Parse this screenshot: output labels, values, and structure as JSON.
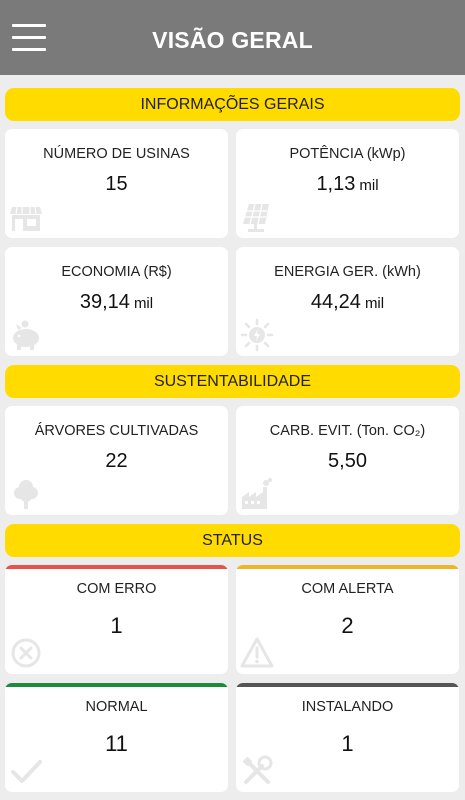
{
  "header": {
    "title": "VISÃO GERAL",
    "menu_icon": "hamburger-menu-icon",
    "bg_color": "#7a7a7a"
  },
  "sections": {
    "general": "INFORMAÇÕES GERAIS",
    "sustainability": "SUSTENTABILIDADE",
    "status": "STATUS"
  },
  "accent_color": "#ffdb00",
  "cards": {
    "plants": {
      "label": "NÚMERO DE USINAS",
      "value": "15",
      "unit": "",
      "icon": "store-icon"
    },
    "power": {
      "label": "POTÊNCIA (kWp)",
      "value": "1,13",
      "unit": "mil",
      "icon": "solar-panel-icon"
    },
    "savings": {
      "label": "ECONOMIA (R$)",
      "value": "39,14",
      "unit": "mil",
      "icon": "piggy-bank-icon"
    },
    "energy": {
      "label": "ENERGIA GER. (kWh)",
      "value": "44,24",
      "unit": "mil",
      "icon": "sun-energy-icon"
    },
    "trees": {
      "label": "ÁRVORES CULTIVADAS",
      "value": "22",
      "unit": "",
      "icon": "tree-icon"
    },
    "carbon": {
      "label": "CARB. EVIT. (Ton. CO₂)",
      "value": "5,50",
      "unit": "",
      "icon": "factory-icon"
    },
    "error": {
      "label": "COM ERRO",
      "value": "1",
      "color": "#e5534b",
      "icon": "error-circle-icon"
    },
    "alert": {
      "label": "COM ALERTA",
      "value": "2",
      "color": "#f0b429",
      "icon": "warning-icon"
    },
    "normal": {
      "label": "NORMAL",
      "value": "11",
      "color": "#1e8a3e",
      "icon": "check-icon"
    },
    "installing": {
      "label": "INSTALANDO",
      "value": "1",
      "color": "#555555",
      "icon": "tools-icon"
    }
  }
}
